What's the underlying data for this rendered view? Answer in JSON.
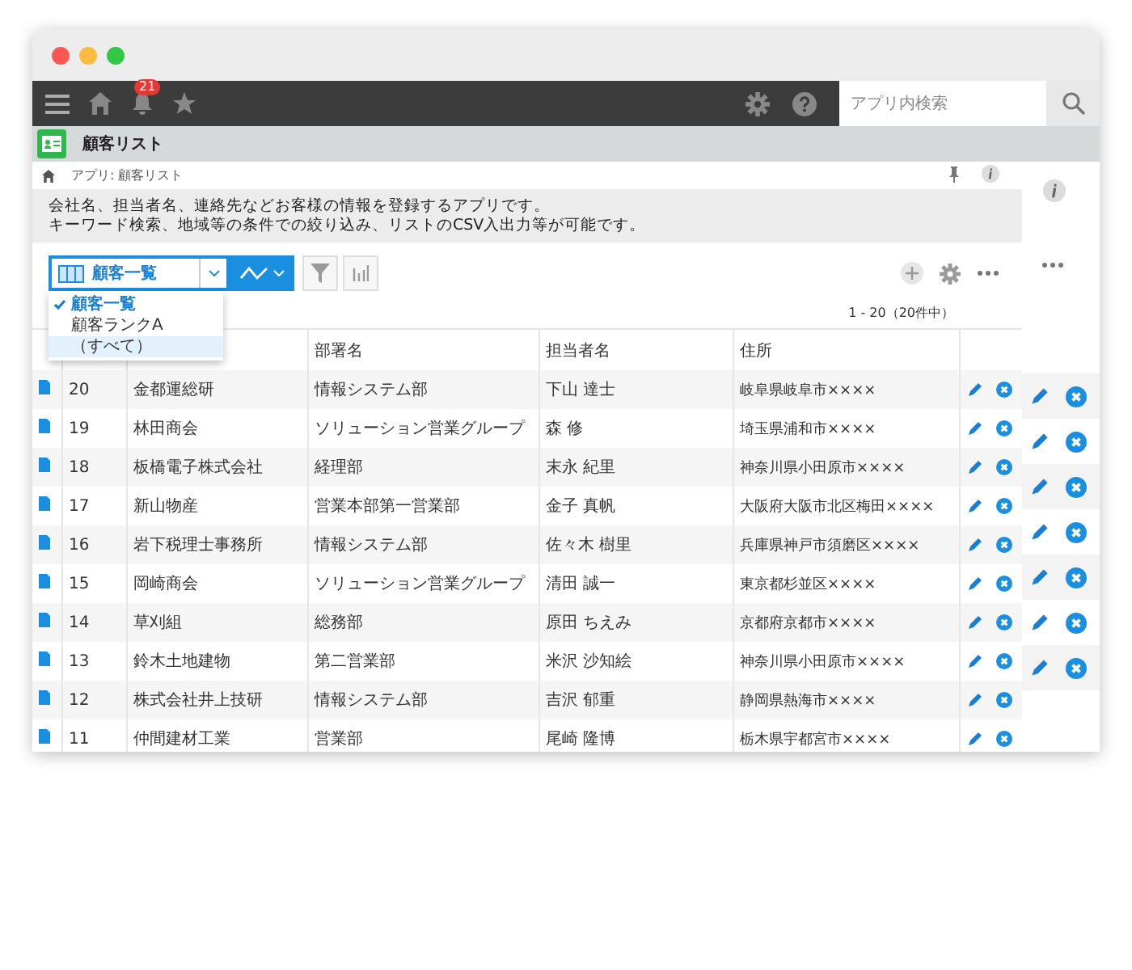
{
  "topbar": {
    "notification_count": "21",
    "search": {
      "placeholder": "アプリ内検索"
    }
  },
  "app": {
    "title": "顧客リスト"
  },
  "breadcrumb": {
    "path": "アプリ: 顧客リスト"
  },
  "description": [
    "会社名、担当者名、連絡先などお客様の情報を登録するアプリです。",
    "キーワード検索、地域等の条件での絞り込み、リストのCSV入出力等が可能です。"
  ],
  "view_select": {
    "value": "顧客一覧"
  },
  "view_menu": {
    "items": [
      {
        "label": "顧客一覧",
        "selected": true,
        "highlighted": false
      },
      {
        "label": "顧客ランクA",
        "selected": false,
        "highlighted": false
      },
      {
        "label": "（すべて）",
        "selected": false,
        "highlighted": true
      }
    ]
  },
  "pagination": "1 - 20（20件中）",
  "table": {
    "columns": [
      {
        "label": "部署名"
      },
      {
        "label": "担当者名"
      },
      {
        "label": "住所"
      }
    ],
    "rows": [
      {
        "column_1": "20",
        "column_2": "金都運総研",
        "department": "情報システム部",
        "person": "下山 達士",
        "address": "岐阜県岐阜市××××"
      },
      {
        "column_1": "19",
        "column_2": "林田商会",
        "department": "ソリューション営業グループ",
        "person": "森 修",
        "address": "埼玉県浦和市××××"
      },
      {
        "column_1": "18",
        "column_2": "板橋電子株式会社",
        "department": "経理部",
        "person": "末永 紀里",
        "address": "神奈川県小田原市××××"
      },
      {
        "column_1": "17",
        "column_2": "新山物産",
        "department": "営業本部第一営業部",
        "person": "金子 真帆",
        "address": "大阪府大阪市北区梅田××××"
      },
      {
        "column_1": "16",
        "column_2": "岩下税理士事務所",
        "department": "情報システム部",
        "person": "佐々木 樹里",
        "address": "兵庫県神戸市須磨区××××"
      },
      {
        "column_1": "15",
        "column_2": "岡崎商会",
        "department": "ソリューション営業グループ",
        "person": "清田 誠一",
        "address": "東京都杉並区××××"
      },
      {
        "column_1": "14",
        "column_2": "草刈組",
        "department": "総務部",
        "person": "原田 ちえみ",
        "address": "京都府京都市××××"
      },
      {
        "column_1": "13",
        "column_2": "鈴木土地建物",
        "department": "第二営業部",
        "person": "米沢 沙知絵",
        "address": "神奈川県小田原市××××"
      },
      {
        "column_1": "12",
        "column_2": "株式会社井上技研",
        "department": "情報システム部",
        "person": "吉沢 郁重",
        "address": "静岡県熱海市××××"
      },
      {
        "column_1": "11",
        "column_2": "仲間建材工業",
        "department": "営業部",
        "person": "尾崎 隆博",
        "address": "栃木県宇都宮市××××"
      }
    ]
  }
}
